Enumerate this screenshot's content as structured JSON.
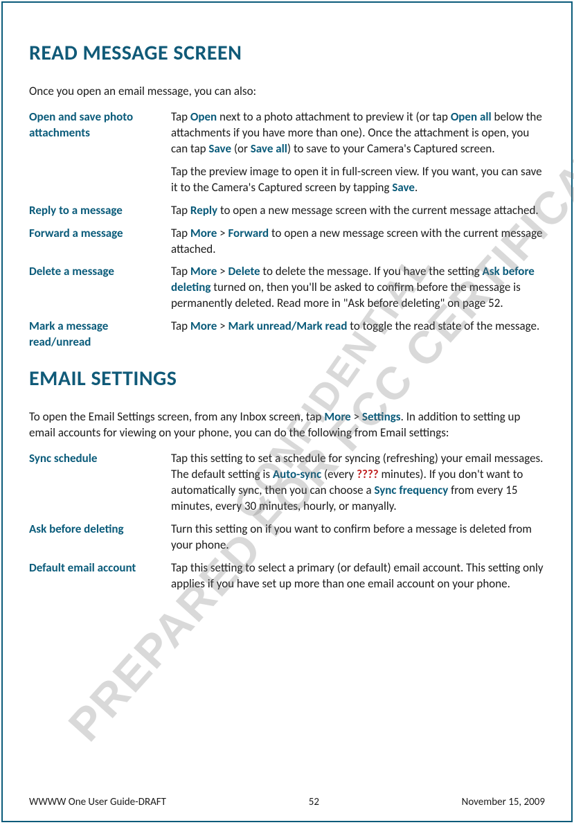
{
  "watermark1": "PREPARED FOR FCC CERTIFICATION",
  "watermark2": "CONFIDENTIAL",
  "heading1": "READ MESSAGE SCREEN",
  "intro1": "Once you open an email message, you can also:",
  "rows1": {
    "r0": {
      "label": "Open and save photo attachments",
      "p0a": "Tap ",
      "p0b": "Open",
      "p0c": " next to a photo attachment to preview it (or tap ",
      "p0d": "Open all",
      "p0e": " below the attachments if you have more than one). Once the attachment is open, you can tap ",
      "p0f": "Save",
      "p0g": " (or ",
      "p0h": "Save all",
      "p0i": ") to save to your Camera's Captured screen.",
      "p1a": "Tap the preview image to open it in full-screen view. If you want, you can save it to the Camera's Captured screen by tapping ",
      "p1b": "Save",
      "p1c": "."
    },
    "r1": {
      "label": "Reply to a message",
      "a": "Tap ",
      "b": "Reply",
      "c": " to open a new message screen with the current message attached."
    },
    "r2": {
      "label": "Forward a message",
      "a": "Tap ",
      "b": "More",
      "c": " > ",
      "d": "Forward",
      "e": " to open a new message screen with the current message attached."
    },
    "r3": {
      "label": "Delete a message",
      "a": "Tap ",
      "b": "More",
      "c": " > ",
      "d": "Delete",
      "e": " to delete the message. If you have the setting ",
      "f": "Ask before deleting",
      "g": " turned on, then you'll be asked to confirm before the message is permanently deleted. Read more in \"Ask before deleting\" on page 52."
    },
    "r4": {
      "label": "Mark a message read/unread",
      "a": "Tap ",
      "b": "More",
      "c": " > ",
      "d": "Mark unread/Mark read",
      "e": " to toggle the read state of the message."
    }
  },
  "heading2": "EMAIL SETTINGS",
  "intro2a": "To open the Email Settings screen, from any Inbox screen, tap ",
  "intro2b": "More",
  "intro2c": " > ",
  "intro2d": "Settings",
  "intro2e": ". In addition to setting up email accounts for viewing on your phone, you can do the following from Email settings:",
  "rows2": {
    "r0": {
      "label": "Sync schedule",
      "a": "Tap this setting to set a schedule for syncing (refreshing) your email messages. The default setting is ",
      "b": "Auto-sync",
      "c": " (every ",
      "d": "????",
      "e": " minutes). If you don't want to automatically sync, then you can choose a ",
      "f": "Sync frequency",
      "g": " from every 15 minutes, every 30 minutes, hourly, or manyally."
    },
    "r1": {
      "label": "Ask before deleting",
      "a": "Turn this setting on if you want to confirm before a message is deleted from your phone."
    },
    "r2": {
      "label": "Default email account",
      "a": "Tap this setting to select a primary (or default) email account. This setting only applies if you have set up more than one email account on your phone."
    }
  },
  "footer": {
    "left": "WWWW One User Guide-DRAFT",
    "center": "52",
    "right": "November 15, 2009"
  }
}
